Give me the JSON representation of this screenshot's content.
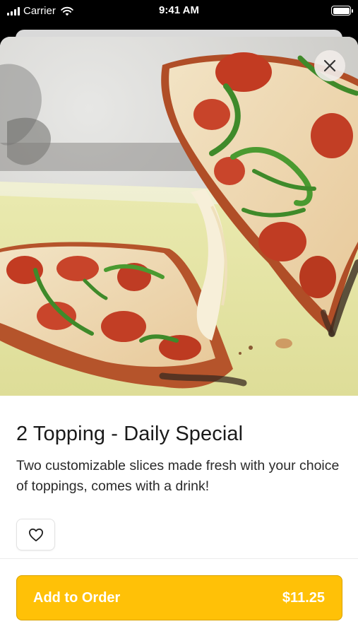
{
  "status_bar": {
    "carrier": "Carrier",
    "time": "9:41 AM"
  },
  "item": {
    "title": "2 Topping - Daily Special",
    "description": "Two customizable slices made fresh with your choice of toppings, comes with a drink!",
    "image_alt": "pizza-photo"
  },
  "actions": {
    "add_label": "Add to Order",
    "price": "$11.25"
  },
  "colors": {
    "accent": "#ffc107",
    "background": "#ffffff",
    "text": "#1a1a1a"
  },
  "icons": [
    "signal-icon",
    "wifi-icon",
    "battery-icon",
    "close-icon",
    "heart-icon"
  ]
}
